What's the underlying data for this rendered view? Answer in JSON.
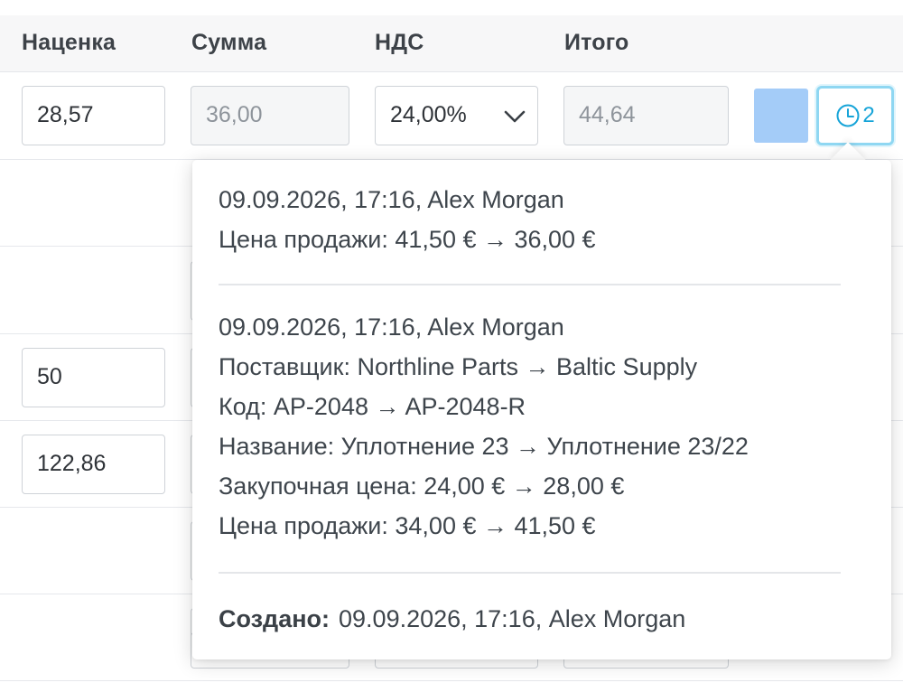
{
  "table": {
    "headers": {
      "markup": "Наценка",
      "sum": "Сумма",
      "vat": "НДС",
      "total": "Итого"
    },
    "rows": [
      {
        "markup": "28,57",
        "sum": "36,00",
        "vat": "24,00%",
        "total": "44,64"
      },
      {
        "markup": "50"
      },
      {
        "markup": "122,86"
      }
    ]
  },
  "swatch_color": "#a4ccf8",
  "history_button": {
    "count": "2",
    "icon": "clock-icon"
  },
  "history": {
    "entries": [
      {
        "header": "09.09.2026, 17:16, Alex Morgan",
        "changes": [
          "Цена продажи: 41,50 € → 36,00 €"
        ]
      },
      {
        "header": "09.09.2026, 17:16, Alex Morgan",
        "changes": [
          "Поставщик: Northline Parts → Baltic Supply",
          "Код: AP-2048 → AP-2048-R",
          "Название: Уплотнение 23 → Уплотнение 23/22",
          "Закупочная цена: 24,00 € → 28,00 €",
          "Цена продажи: 34,00 € → 41,50 €"
        ]
      }
    ],
    "created_label": "Создано:",
    "created_value": "09.09.2026, 17:16, Alex Morgan"
  }
}
